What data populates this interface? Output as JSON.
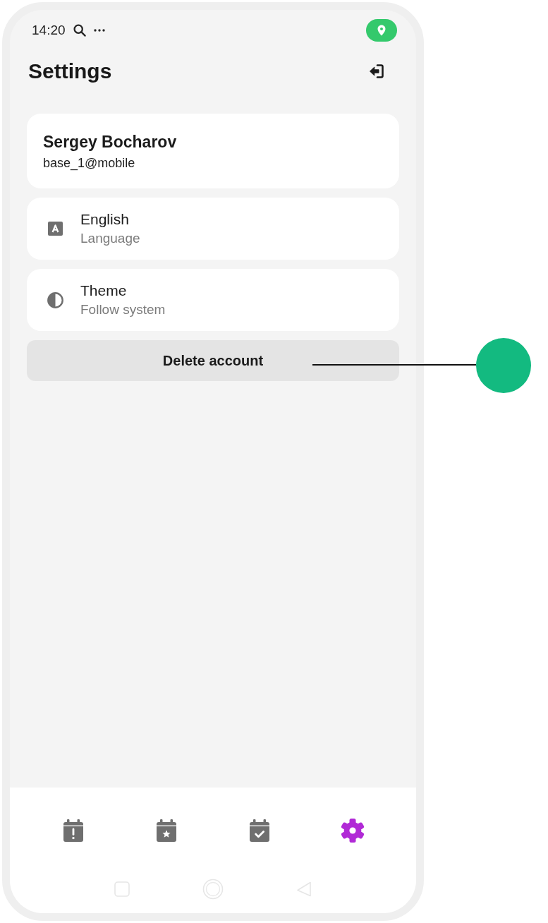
{
  "status_bar": {
    "time": "14:20"
  },
  "header": {
    "title": "Settings"
  },
  "profile": {
    "name": "Sergey Bocharov",
    "account": "base_1@mobile"
  },
  "settings": [
    {
      "kind": "language",
      "title": "English",
      "subtitle": "Language"
    },
    {
      "kind": "theme",
      "title": "Theme",
      "subtitle": "Follow system"
    }
  ],
  "delete_button": {
    "label": "Delete account"
  },
  "annotation": {
    "kind": "marker"
  },
  "bottom_nav": {
    "items": [
      {
        "kind": "calendar_alert",
        "selected": false
      },
      {
        "kind": "calendar_star",
        "selected": false
      },
      {
        "kind": "calendar_check",
        "selected": false
      },
      {
        "kind": "settings",
        "selected": true
      }
    ]
  }
}
